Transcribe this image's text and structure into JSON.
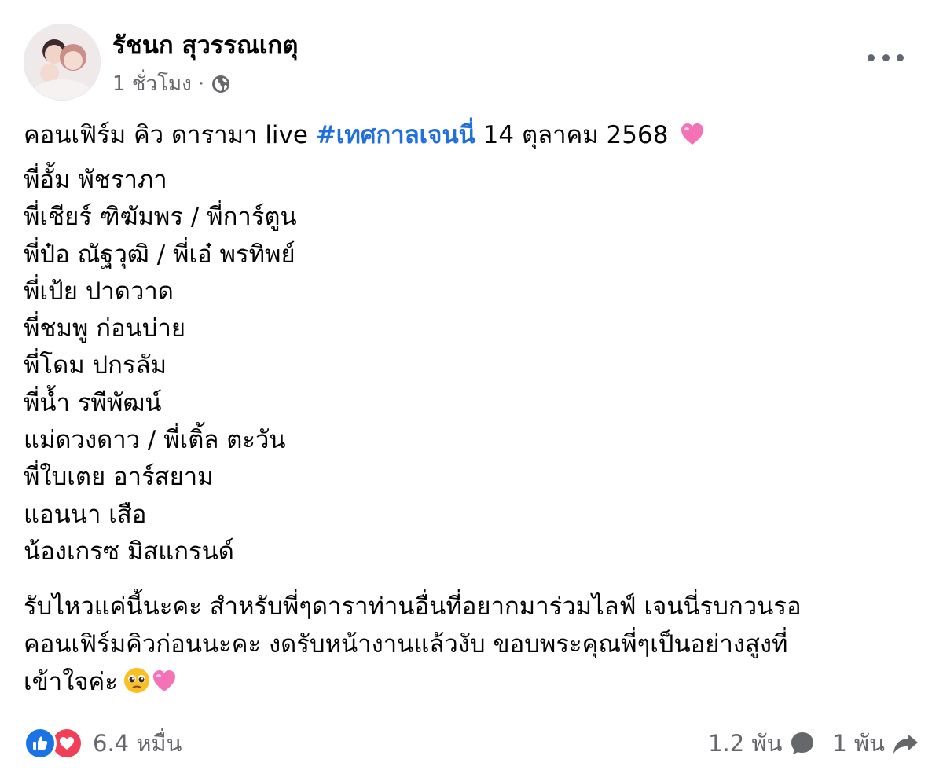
{
  "post": {
    "author": "รัชนก สุวรรณเกตุ",
    "time": "1 ชั่วโมง",
    "separator": "·",
    "intro_text": "คอนเฟิร์ม คิว ดารามา live ",
    "hashtag": "#เทศกาลเจนนี่",
    "intro_date": " 14 ตุลาคม 2568",
    "names": [
      "พี่อั้ม พัชราภา",
      "พี่เชียร์ ฑิฆัมพร / พี่การ์ตูน",
      "พี่ป๋อ ณัฐวุฒิ / พี่เอ๋ พรทิพย์",
      "พี่เป้ย ปาดวาด",
      "พี่ชมพู ก่อนบ่าย",
      "พี่โดม ปกรลัม",
      "พี่น้ำ รพีพัฒน์",
      "แม่ดวงดาว / พี่เติ้ล ตะวัน",
      "พี่ใบเตย อาร์สยาม",
      "แอนนา เสือ",
      "น้องเกรซ มิสแกรนด์"
    ],
    "outro_lines": [
      "รับไหวแค่นี้นะคะ สำหรับพี่ๆดาราท่านอื่นที่อยากมาร่วมไลฟ์ เจนนี่รบกวนรอ",
      "คอนเฟิร์มคิวก่อนนะคะ งดรับหน้างานแล้วงับ ขอบพระคุณพี่ๆเป็นอย่างสูงที่",
      "เข้าใจค่ะ"
    ]
  },
  "footer": {
    "reactions_count": "6.4 หมื่น",
    "comments_count": "1.2 พัน",
    "shares_count": "1 พัน"
  },
  "icons": {
    "globe": "globe-icon",
    "more": "more-options-icon",
    "like": "like-reaction-icon",
    "love": "love-reaction-icon",
    "comment": "comment-icon",
    "share": "share-icon",
    "heart": "pink-heart-emoji",
    "pleading": "pleading-face-emoji"
  },
  "colors": {
    "hashtag": "#216fdb",
    "secondary_text": "#65676b",
    "like_blue": "#1b74e4",
    "love_red": "#f33e58"
  }
}
